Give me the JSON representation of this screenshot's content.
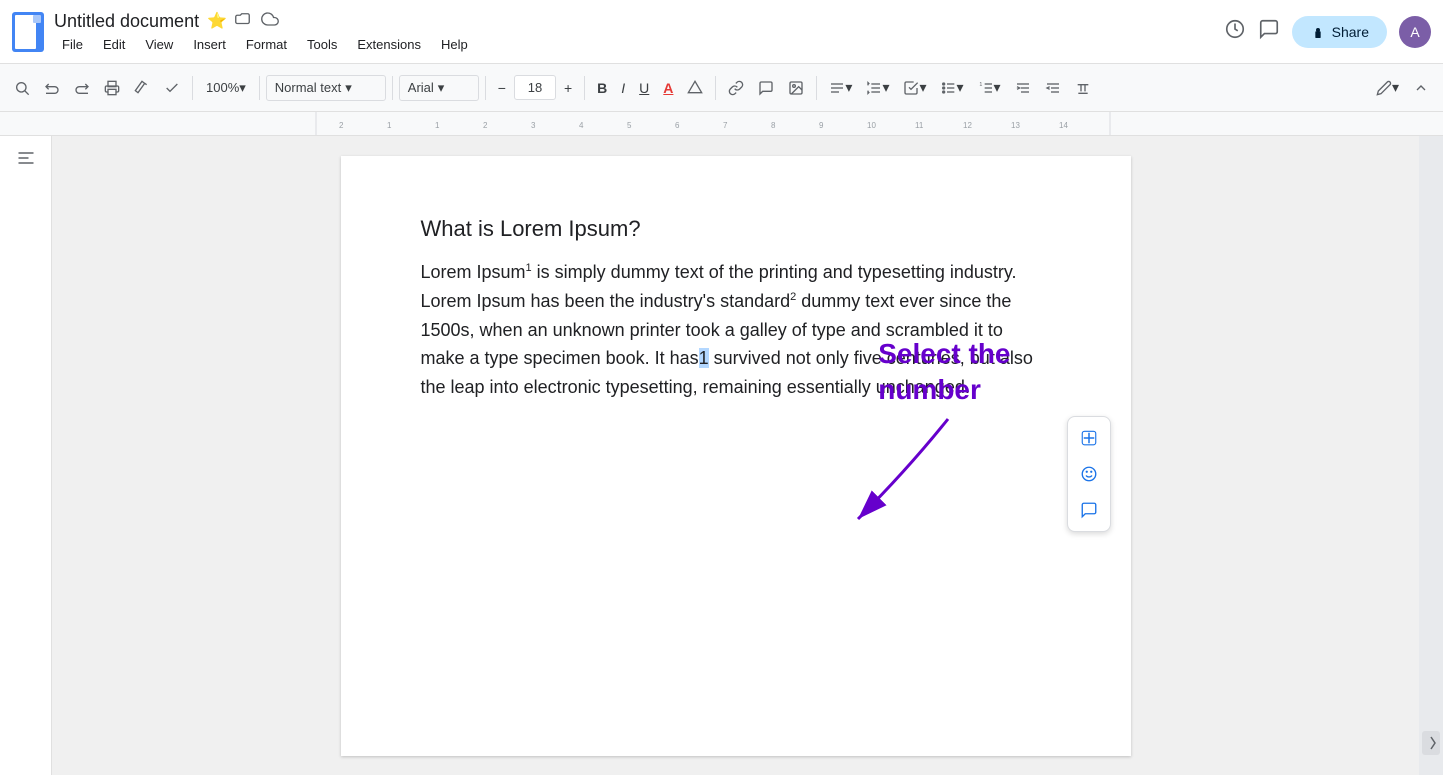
{
  "titlebar": {
    "doc_icon_label": "Docs",
    "title": "Untitled document",
    "star_icon": "⭐",
    "folder_icon": "📁",
    "cloud_icon": "☁",
    "menus": [
      "File",
      "Edit",
      "View",
      "Insert",
      "Format",
      "Tools",
      "Extensions",
      "Help"
    ],
    "history_icon": "🕐",
    "comment_icon": "💬",
    "share_label": "Share",
    "share_icon": "🔒",
    "avatar_initials": "A"
  },
  "toolbar": {
    "search_icon": "🔍",
    "undo_icon": "↩",
    "redo_icon": "↪",
    "print_icon": "🖨",
    "paint_format_icon": "🎨",
    "spell_check_icon": "✓",
    "zoom_value": "100%",
    "style_value": "Normal text",
    "font_value": "Arial",
    "font_size": "18",
    "decrease_size": "−",
    "increase_size": "+",
    "bold_label": "B",
    "italic_label": "I",
    "underline_label": "U",
    "text_color_icon": "A",
    "highlight_icon": "✏",
    "link_icon": "🔗",
    "comment_icon": "💬",
    "image_icon": "🖼",
    "align_icon": "≡",
    "line_spacing_icon": "↕",
    "checklist_icon": "☑",
    "list_icon": "☰",
    "num_list_icon": "≡",
    "indent_more": "→",
    "indent_less": "←",
    "clear_format": "T",
    "edit_pen": "✏",
    "collapse": "⌃"
  },
  "document": {
    "heading": "What is Lorem Ipsum?",
    "paragraph": "Lorem Ipsum",
    "sup1": "1",
    "text1": " is simply dummy text of the printing and typesetting industry. Lorem Ipsum has been the industry's standard",
    "sup2": "2",
    "text2": " dummy text ever since the 1500s, when an unknown printer took a galley of type and scrambled it to make a type specimen book. It has",
    "selected": "1",
    "text3": " survived not only five centuries, but also the leap into electronic typesetting, remaining essentially unchanged."
  },
  "annotation": {
    "line1": "Select the",
    "line2": "number"
  },
  "float_toolbar": {
    "add_icon": "＋",
    "emoji_icon": "☺",
    "comment_icon": "🗨"
  },
  "colors": {
    "accent_blue": "#4285f4",
    "annotation_purple": "#6600cc",
    "selected_bg": "#b3d7ff",
    "share_bg": "#c2e7ff"
  }
}
